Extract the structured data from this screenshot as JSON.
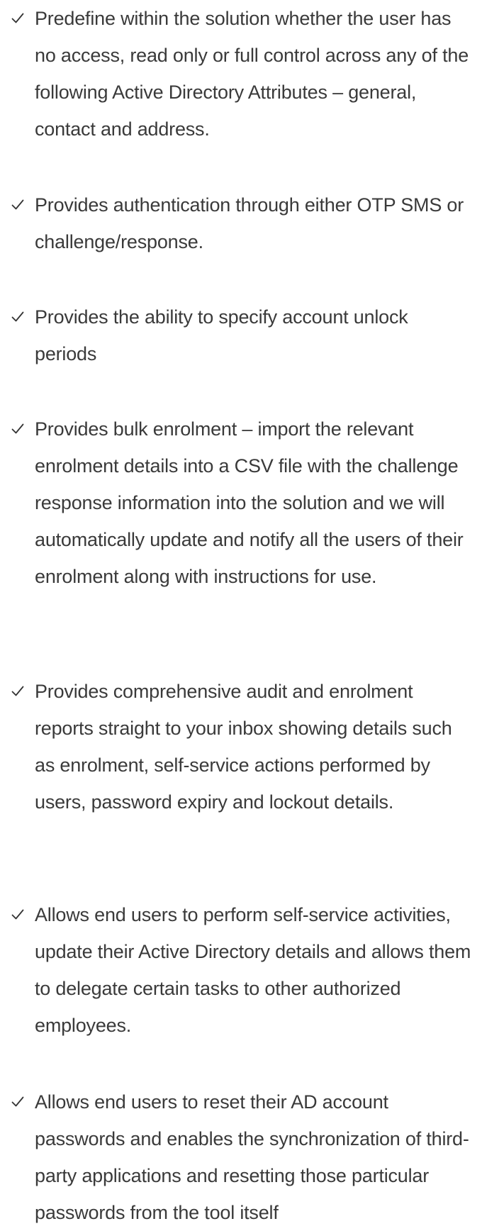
{
  "features": {
    "items": [
      {
        "text": "Predefine within the solution whether the user has no access, read only or full control across any of the following Active Directory Attributes – general, contact and address."
      },
      {
        "text": "Provides authentication through either OTP SMS or challenge/response."
      },
      {
        "text": "Provides the ability to specify account unlock periods"
      },
      {
        "text": "Provides bulk enrolment – import the relevant enrolment details into a CSV file with the challenge response information into the solution and we will automatically update and notify all the users of their enrolment along with instructions for use."
      },
      {
        "text": "Provides comprehensive audit and enrolment reports straight to your inbox showing details such as enrolment, self-service actions performed by users, password expiry and lockout details."
      },
      {
        "text": "Allows end users to perform self-service activities, update their Active Directory details and allows them to delegate certain tasks to other authorized employees."
      },
      {
        "text": "Allows end users to reset their AD account passwords and enables the synchronization of third-party applications and resetting those particular passwords from the tool itself"
      }
    ]
  }
}
